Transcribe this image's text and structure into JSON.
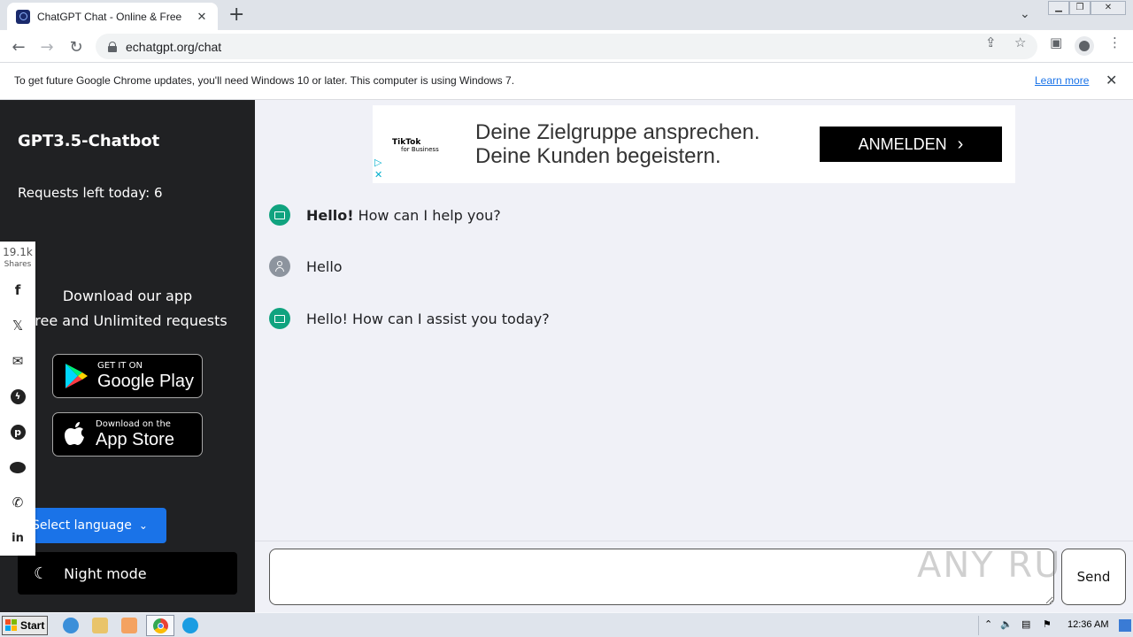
{
  "browser": {
    "tab_title": "ChatGPT Chat - Online & Free",
    "url": "echatgpt.org/chat",
    "infobar_text": "To get future Google Chrome updates, you'll need Windows 10 or later. This computer is using Windows 7.",
    "infobar_link": "Learn more"
  },
  "sidebar": {
    "title": "GPT3.5-Chatbot",
    "requests": "Requests left today: 6",
    "download_title": "Download our app",
    "download_sub": "Free and Unlimited requests",
    "google_play": {
      "small": "GET IT ON",
      "big": "Google Play"
    },
    "app_store": {
      "small": "Download on the",
      "big": "App Store"
    },
    "language_button": "Select language",
    "night_mode": "Night mode"
  },
  "share": {
    "count": "19.1k",
    "label": "Shares",
    "networks": [
      "facebook-icon",
      "x-icon",
      "email-icon",
      "messenger-icon",
      "pinterest-icon",
      "reddit-icon",
      "whatsapp-icon",
      "linkedin-icon"
    ]
  },
  "ad": {
    "brand": "TikTok",
    "brand_sub": "for Business",
    "line1": "Deine Zielgruppe ansprechen.",
    "line2": "Deine Kunden begeistern.",
    "cta": "ANMELDEN"
  },
  "messages": [
    {
      "role": "bot",
      "bold": "Hello!",
      "text": " How can I help you?"
    },
    {
      "role": "user",
      "bold": "",
      "text": "Hello"
    },
    {
      "role": "bot",
      "bold": "",
      "text": "Hello! How can I assist you today?"
    }
  ],
  "input": {
    "placeholder": "",
    "send_label": "Send"
  },
  "watermark": "ANY RUN",
  "taskbar": {
    "start": "Start",
    "clock": "12:36 AM"
  },
  "colors": {
    "sidebar_bg": "#202123",
    "bot_avatar": "#10a37f",
    "language_button": "#1a73e8",
    "chat_bg": "#f0f1f7"
  }
}
